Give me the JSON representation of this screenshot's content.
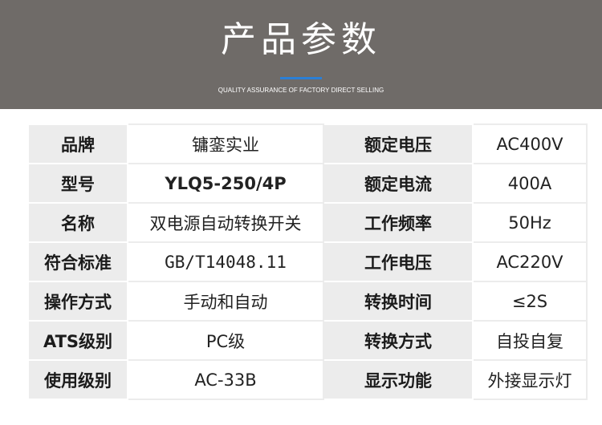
{
  "header": {
    "title": "产品参数",
    "subtitle": "QUALITY ASSURANCE OF FACTORY DIRECT SELLING",
    "accent_color": "#2b7fd6",
    "background_color": "#6f6b68"
  },
  "specs": [
    {
      "label": "品牌",
      "value": "镛銮实业",
      "label2": "额定电压",
      "value2": "AC400V"
    },
    {
      "label": "型号",
      "value": "YLQ5-250/4P",
      "label2": "额定电流",
      "value2": "400A"
    },
    {
      "label": "名称",
      "value": "双电源自动转换开关",
      "label2": "工作频率",
      "value2": "50Hz"
    },
    {
      "label": "符合标准",
      "value": "GB/T14048.11",
      "label2": "工作电压",
      "value2": "AC220V"
    },
    {
      "label": "操作方式",
      "value": "手动和自动",
      "label2": "转换时间",
      "value2": "≤2S"
    },
    {
      "label": "ATS级别",
      "value": "PC级",
      "label2": "转换方式",
      "value2": "自投自复"
    },
    {
      "label": "使用级别",
      "value": "AC-33B",
      "label2": "显示功能",
      "value2": "外接显示灯"
    }
  ]
}
